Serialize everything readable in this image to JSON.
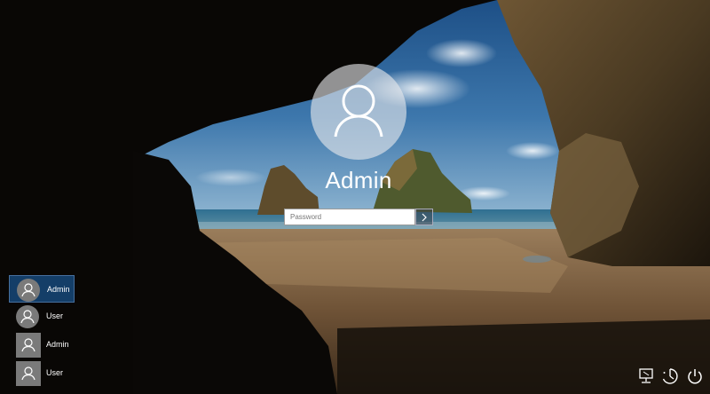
{
  "login": {
    "username": "Admin",
    "password_placeholder": "Password"
  },
  "icons": {
    "avatar": "user-icon",
    "submit": "arrow-right-icon",
    "network": "network-icon",
    "ease_of_access": "ease-of-access-icon",
    "power": "power-icon"
  },
  "user_list": [
    {
      "label": "Admin",
      "selected": true,
      "avatar": "round"
    },
    {
      "label": "User",
      "selected": false,
      "avatar": "round"
    },
    {
      "label": "Admin",
      "selected": false,
      "avatar": "square"
    },
    {
      "label": "User",
      "selected": false,
      "avatar": "square"
    }
  ],
  "colors": {
    "selected_tile": "#174e84",
    "avatar_gray": "#7a7a7a"
  }
}
